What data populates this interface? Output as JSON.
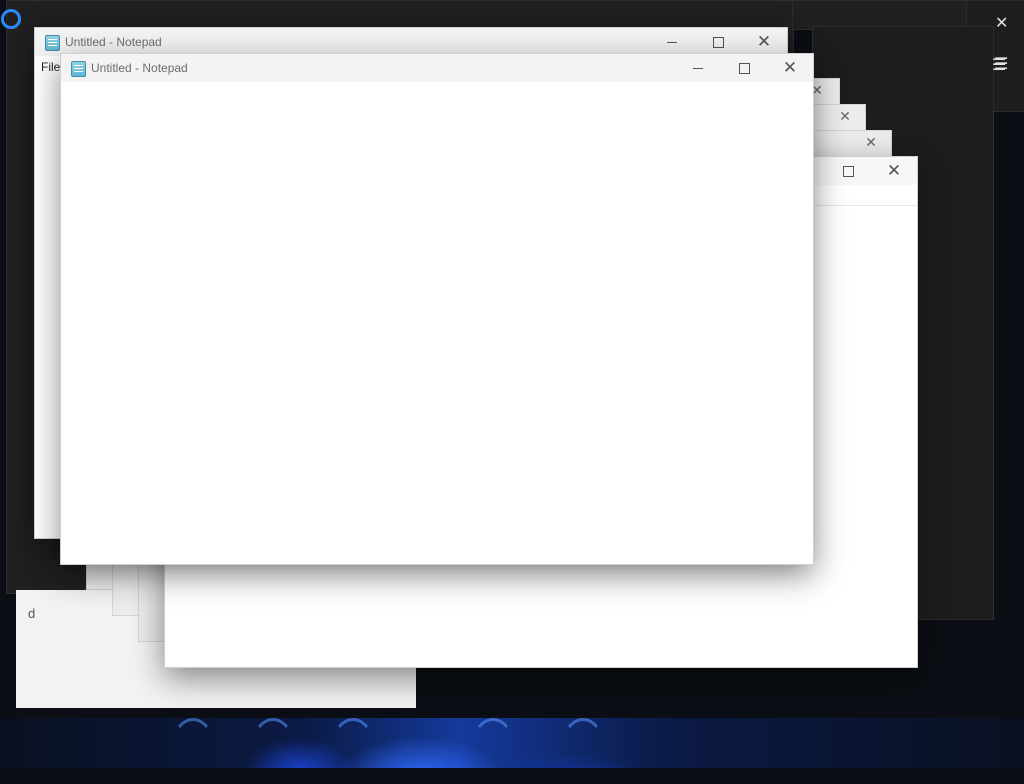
{
  "notepad": {
    "title": "Untitled - Notepad",
    "menu_file": "File",
    "control_min": "",
    "control_max": "",
    "control_close": "✕"
  },
  "background": {
    "close_glyph": "✕",
    "hamburger_glyph": "☰",
    "partial_text": "d"
  },
  "icons": {
    "notepad": "notepad-icon",
    "cortana": "cortana-ring-icon",
    "minimize": "minimize-icon",
    "maximize": "maximize-icon",
    "close": "close-icon",
    "menu": "hamburger-icon"
  },
  "colors": {
    "accent": "#2a8cff",
    "titlebar": "#f3f3f3",
    "dark_window": "#202020"
  }
}
